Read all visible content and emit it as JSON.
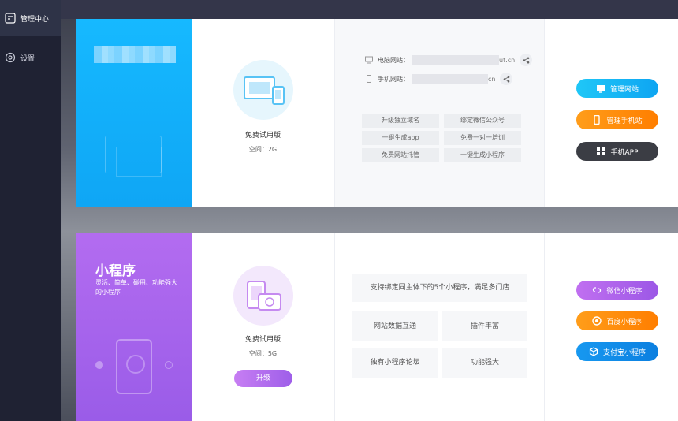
{
  "sidebar": {
    "items": [
      {
        "label": "管理中心",
        "icon": "edit-square-icon"
      },
      {
        "label": "设置",
        "icon": "settings-circle-icon"
      }
    ]
  },
  "site_card": {
    "plan_name": "免费试用版",
    "space": "空间：2G",
    "pc_label": "电脑网站：",
    "pc_suffix": "ut.cn",
    "mobile_label": "手机网站：",
    "mobile_suffix": "cn",
    "features": [
      "升级独立域名",
      "绑定微信公众号",
      "一键生成app",
      "免费一对一培训",
      "免费网站托管",
      "一键生成小程序"
    ],
    "buttons": {
      "manage_site": "管理网站",
      "manage_mobile": "管理手机站",
      "mobile_app": "手机APP"
    }
  },
  "mini_card": {
    "title": "小程序",
    "description": "灵活、简单、碰用、功能强大的小程序",
    "plan_name": "免费试用版",
    "space": "空间：5G",
    "upgrade": "升级",
    "support": "支持绑定同主体下的5个小程序，满足多门店",
    "features": [
      "网站数据互通",
      "插件丰富",
      "独有小程序论坛",
      "功能强大"
    ],
    "buttons": {
      "wechat": "微信小程序",
      "baidu": "百度小程序",
      "alipay": "支付宝小程序"
    }
  },
  "colors": {
    "sidebar_bg": "#1f2233",
    "site_banner": "#16b9ff",
    "mini_banner": "#b36cf0",
    "blue": "#0ea5f2",
    "orange": "#ff7e00",
    "dark": "#3b3d44",
    "purple": "#9c58e6"
  }
}
